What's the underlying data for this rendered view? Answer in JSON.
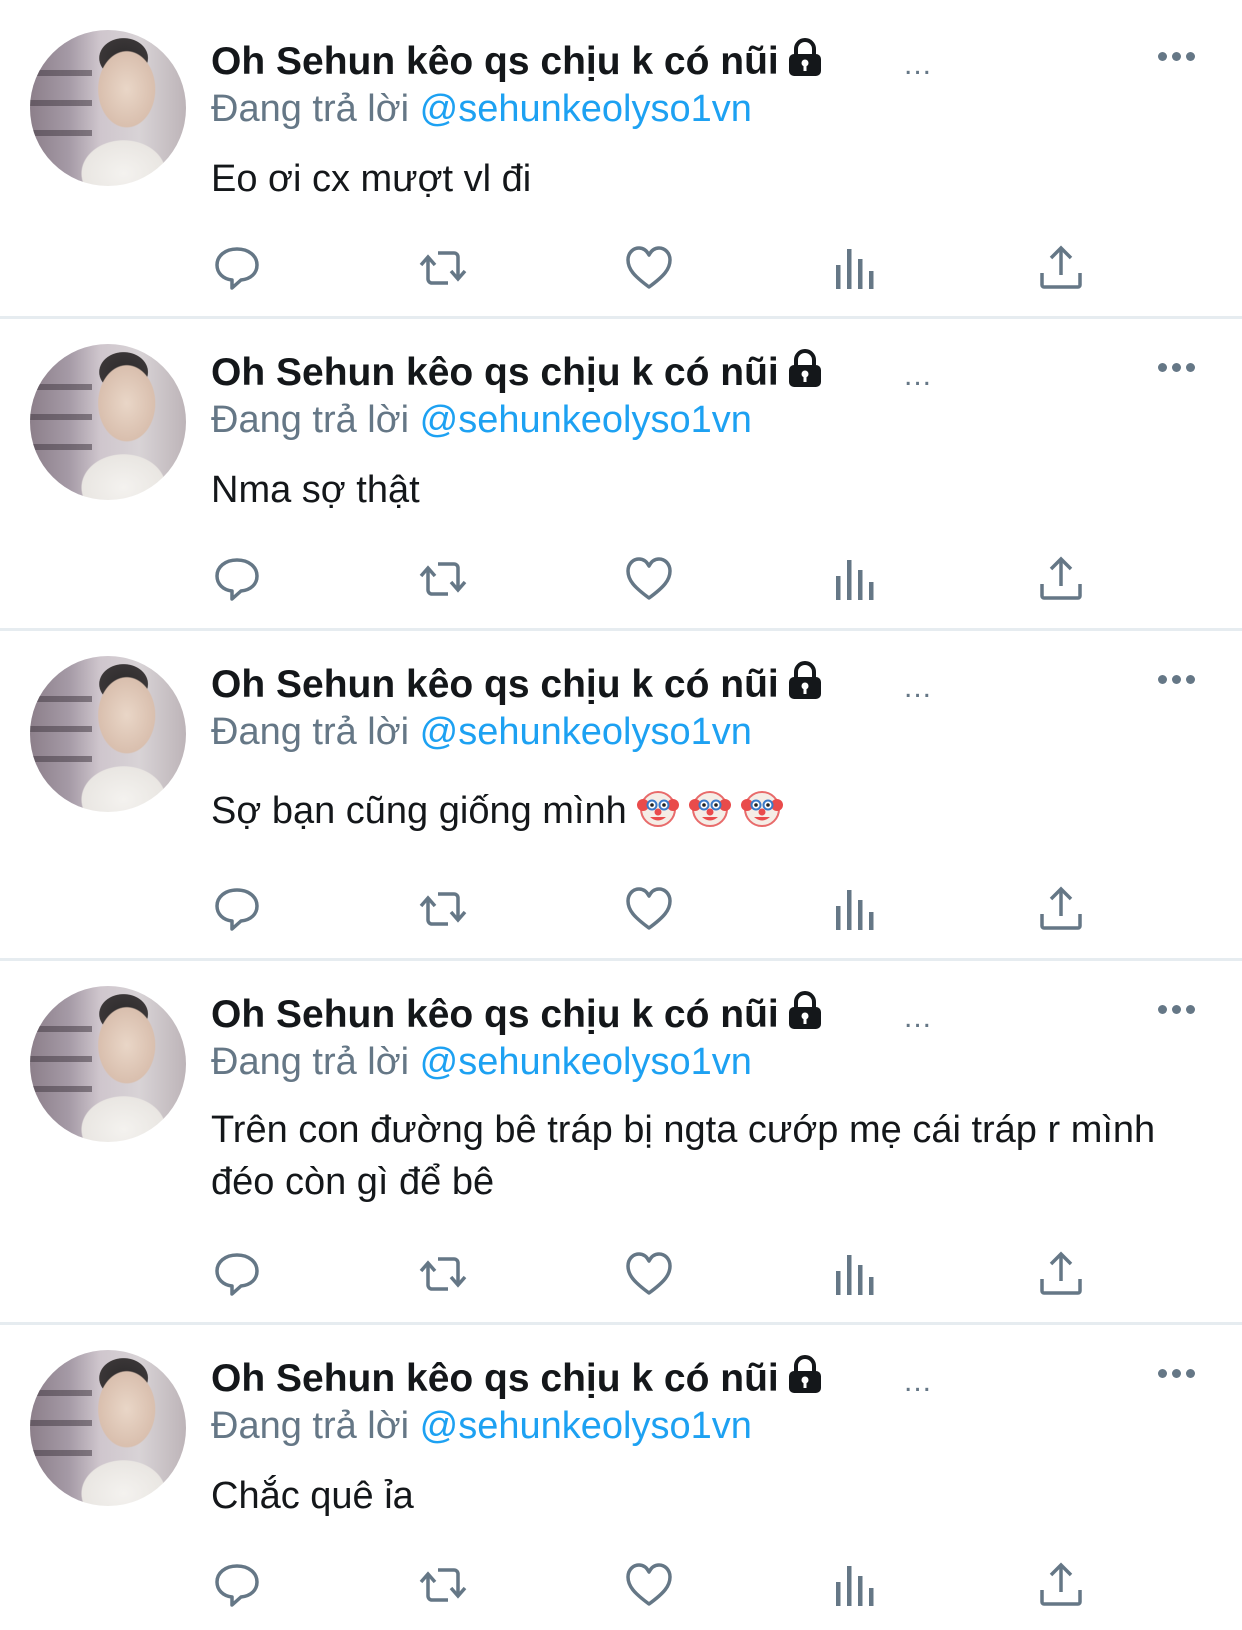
{
  "tweets": [
    {
      "author": "Oh Sehun kêo qs chịu k có nũi",
      "truncation": "...",
      "reply_label": "Đang trả lời",
      "reply_handle": "@sehunkeolyso1vn",
      "text": "Eo ơi cx mượt vl đi",
      "emoji_count": 0
    },
    {
      "author": "Oh Sehun kêo qs chịu k có nũi",
      "truncation": "...",
      "reply_label": "Đang trả lời",
      "reply_handle": "@sehunkeolyso1vn",
      "text": "Nma sợ thật",
      "emoji_count": 0
    },
    {
      "author": "Oh Sehun kêo qs chịu k có nũi",
      "truncation": "...",
      "reply_label": "Đang trả lời",
      "reply_handle": "@sehunkeolyso1vn",
      "text": "Sợ bạn cũng giống mình",
      "emoji": "clown-face",
      "emoji_count": 3
    },
    {
      "author": "Oh Sehun kêo qs chịu k có nũi",
      "truncation": "...",
      "reply_label": "Đang trả lời",
      "reply_handle": "@sehunkeolyso1vn",
      "text": "Trên con đường bê tráp bị ngta cướp mẹ cái tráp r mình đéo còn gì để bê",
      "emoji_count": 0
    },
    {
      "author": "Oh Sehun kêo qs chịu k có nũi",
      "truncation": "...",
      "reply_label": "Đang trả lời",
      "reply_handle": "@sehunkeolyso1vn",
      "text": "Chắc quê ỉa",
      "emoji_count": 0
    }
  ],
  "icons": {
    "account": "lock-icon",
    "menu": "more-options-icon",
    "actions": [
      "reply-icon",
      "retweet-icon",
      "like-icon",
      "analytics-icon",
      "share-icon"
    ]
  },
  "colors": {
    "text": "#14171a",
    "secondary": "#657786",
    "link": "#1da1f2",
    "divider": "#e6ecf0"
  }
}
